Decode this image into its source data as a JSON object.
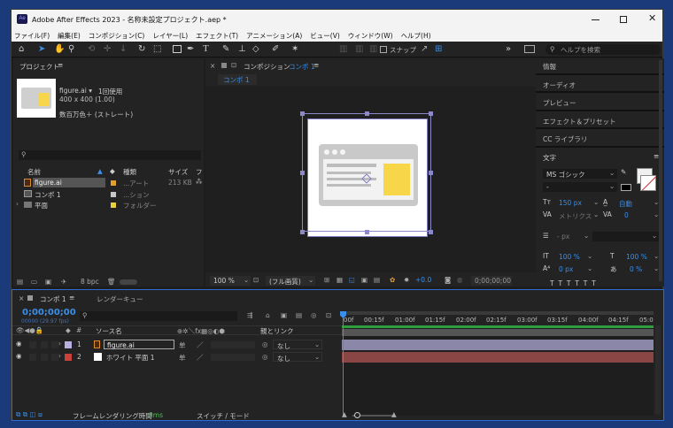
{
  "window": {
    "title": "Adobe After Effects 2023 - 名称未設定プロジェクト.aep *",
    "app_badge": "Ae"
  },
  "menu": [
    "ファイル(F)",
    "編集(E)",
    "コンポジション(C)",
    "レイヤー(L)",
    "エフェクト(T)",
    "アニメーション(A)",
    "ビュー(V)",
    "ウィンドウ(W)",
    "ヘルプ(H)"
  ],
  "toolbar": {
    "snap_label": "スナップ",
    "help_search_placeholder": "ヘルプを検索"
  },
  "project": {
    "title": "プロジェクト",
    "selected_name": "figure.ai ▾",
    "usage": "1回使用",
    "size": "400 x 400 (1.00)",
    "colors": "数百万色＋ (ストレート)",
    "columns": {
      "name": "名前",
      "type": "種類",
      "size": "サイズ",
      "frame": "フ"
    },
    "items": [
      {
        "name": "figure.ai",
        "type": "...アート",
        "size": "213 KB",
        "label_color": "#e0a02a"
      },
      {
        "name": "コンポ 1",
        "type": "...ション",
        "size": "",
        "label_color": "#c8c8c8"
      },
      {
        "name": "平面",
        "type": "フォルダー",
        "size": "",
        "label_color": "#e8d13a"
      }
    ],
    "bpc": "8 bpc"
  },
  "composition": {
    "title": "コンポジション",
    "name": "コンポ 1",
    "tab": "コンポ 1",
    "zoom": "100 %",
    "quality": "(フル画質)",
    "exposure": "+0.0",
    "timecode": "0;00;00;00"
  },
  "right_panels": [
    "情報",
    "オーディオ",
    "プレビュー",
    "エフェクト＆プリセット",
    "CC ライブラリ"
  ],
  "character": {
    "title": "文字",
    "font": "MS ゴシック",
    "style": "-",
    "font_size": "150 px",
    "leading": "自動",
    "kerning": "メトリクス",
    "tracking": "0",
    "stroke": "- px",
    "vscale": "100 %",
    "hscale": "100 %",
    "baseline": "0 px",
    "tsume": "0 %"
  },
  "timeline": {
    "tab": "コンポ 1",
    "render_queue": "レンダーキュー",
    "timecode": "0;00;00;00",
    "fps": "00000 (29.97 fps)",
    "col_source": "ソース名",
    "col_parent": "親とリンク",
    "col_num": "#",
    "ruler": [
      "00f",
      "00:15f",
      "01:00f",
      "01:15f",
      "02:00f",
      "02:15f",
      "03:00f",
      "03:15f",
      "04:00f",
      "04:15f",
      "05:0"
    ],
    "layers": [
      {
        "num": "1",
        "name": "figure.ai",
        "parent": "なし",
        "label_color": "#b7b1e0",
        "bar_color": "#8a87a8"
      },
      {
        "num": "2",
        "name": "ホワイト 平面 1",
        "parent": "なし",
        "label_color": "#c8413a",
        "bar_color": "#8a4545"
      }
    ],
    "frame_render_label": "フレームレンダリング時間",
    "frame_render_value": "0ms",
    "switch_mode": "スイッチ / モード"
  },
  "colors": {
    "accent": "#3b8ee8",
    "panel": "#232323",
    "timeline_border": "#2d6bd6"
  }
}
